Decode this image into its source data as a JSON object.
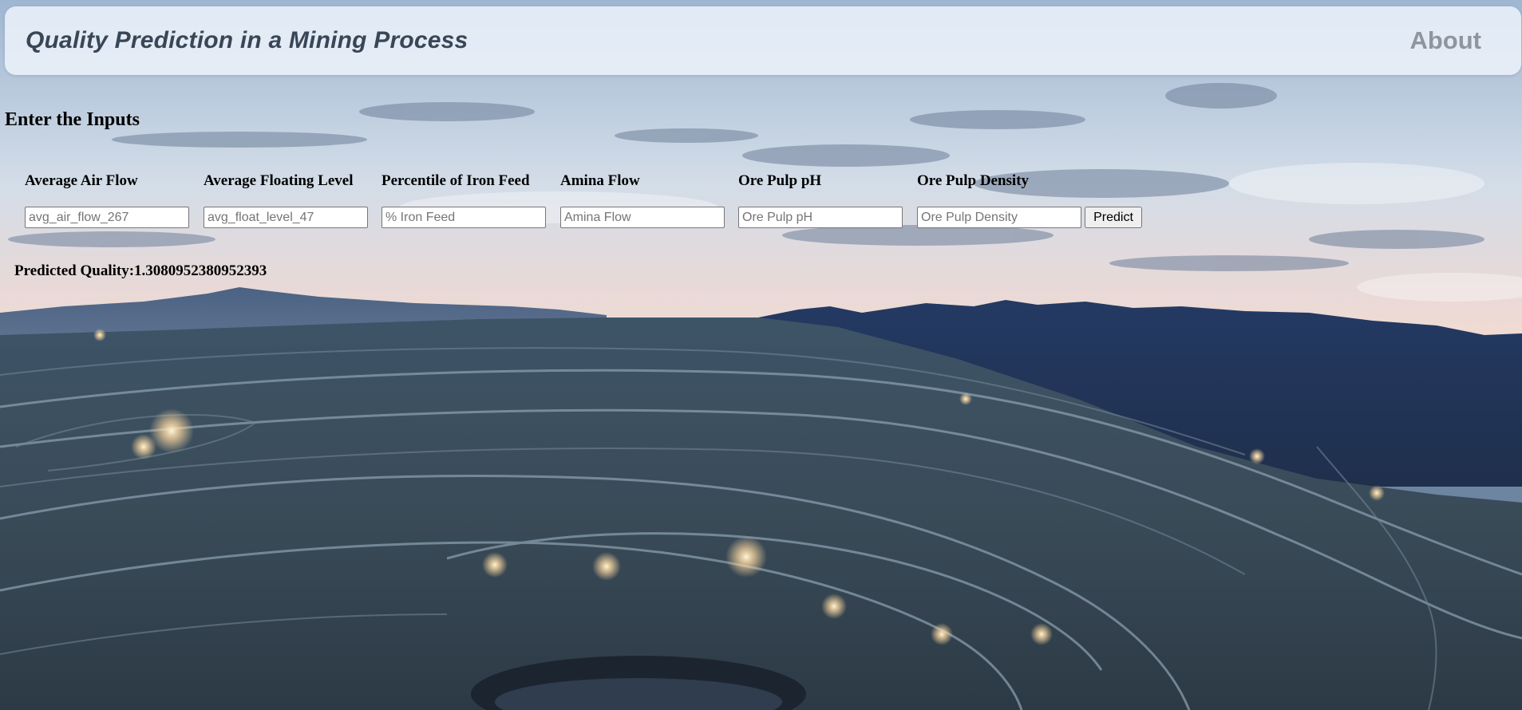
{
  "header": {
    "title": "Quality Prediction in a Mining Process",
    "about_label": "About"
  },
  "form": {
    "title": "Enter the Inputs",
    "fields": [
      {
        "label": "Average Air Flow",
        "placeholder": "avg_air_flow_267"
      },
      {
        "label": "Average Floating Level",
        "placeholder": "avg_float_level_47"
      },
      {
        "label": "Percentile of Iron Feed",
        "placeholder": "% Iron Feed"
      },
      {
        "label": "Amina Flow",
        "placeholder": "Amina Flow"
      },
      {
        "label": "Ore Pulp pH",
        "placeholder": "Ore Pulp pH"
      },
      {
        "label": "Ore Pulp Density",
        "placeholder": "Ore Pulp Density"
      }
    ],
    "predict_label": "Predict"
  },
  "result": {
    "text": "Predicted Quality:1.3080952380952393"
  },
  "colors": {
    "header_bg": "#ecf2fa",
    "header_title": "#384656",
    "about_link": "#8e959e"
  }
}
